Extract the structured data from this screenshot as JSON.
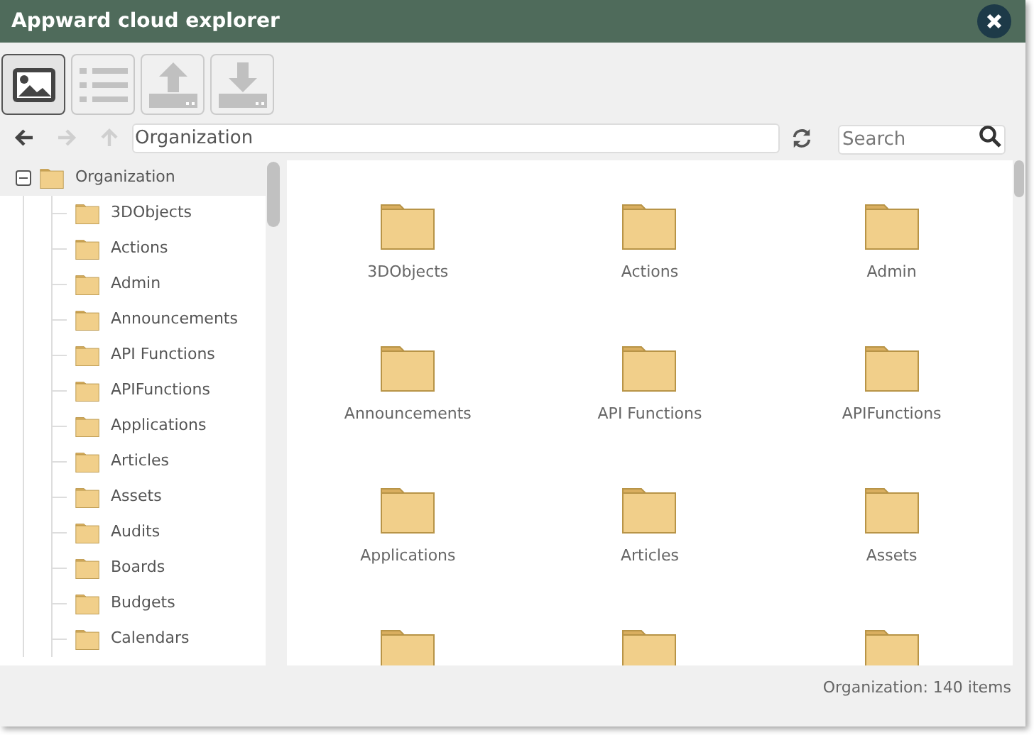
{
  "window": {
    "title": "Appward cloud explorer"
  },
  "toolbar": [
    {
      "kind": "image-view",
      "selected": true
    },
    {
      "kind": "list-view",
      "selected": false
    },
    {
      "kind": "upload",
      "disabled": true
    },
    {
      "kind": "download",
      "disabled": true
    }
  ],
  "nav": [
    {
      "kind": "back",
      "disabled": false
    },
    {
      "kind": "forward",
      "disabled": true
    },
    {
      "kind": "up",
      "disabled": true
    }
  ],
  "path": {
    "value": "Organization"
  },
  "search": {
    "placeholder": "Search"
  },
  "tree": {
    "label": "Organization",
    "expanded": true,
    "selected": true,
    "children": [
      {
        "label": "3DObjects"
      },
      {
        "label": "Actions"
      },
      {
        "label": "Admin"
      },
      {
        "label": "Announcements"
      },
      {
        "label": "API Functions"
      },
      {
        "label": "APIFunctions"
      },
      {
        "label": "Applications"
      },
      {
        "label": "Articles"
      },
      {
        "label": "Assets"
      },
      {
        "label": "Audits"
      },
      {
        "label": "Boards"
      },
      {
        "label": "Budgets"
      },
      {
        "label": "Calendars"
      }
    ]
  },
  "items": [
    {
      "kind": "folder",
      "label": "3DObjects"
    },
    {
      "kind": "folder",
      "label": "Actions"
    },
    {
      "kind": "folder",
      "label": "Admin"
    },
    {
      "kind": "folder",
      "label": "Announcements"
    },
    {
      "kind": "folder",
      "label": "API Functions"
    },
    {
      "kind": "folder",
      "label": "APIFunctions"
    },
    {
      "kind": "folder",
      "label": "Applications"
    },
    {
      "kind": "folder",
      "label": "Articles"
    },
    {
      "kind": "folder",
      "label": "Assets"
    },
    {
      "kind": "folder"
    },
    {
      "kind": "folder"
    },
    {
      "kind": "folder"
    }
  ],
  "status_bar": "Organization: 140 items"
}
